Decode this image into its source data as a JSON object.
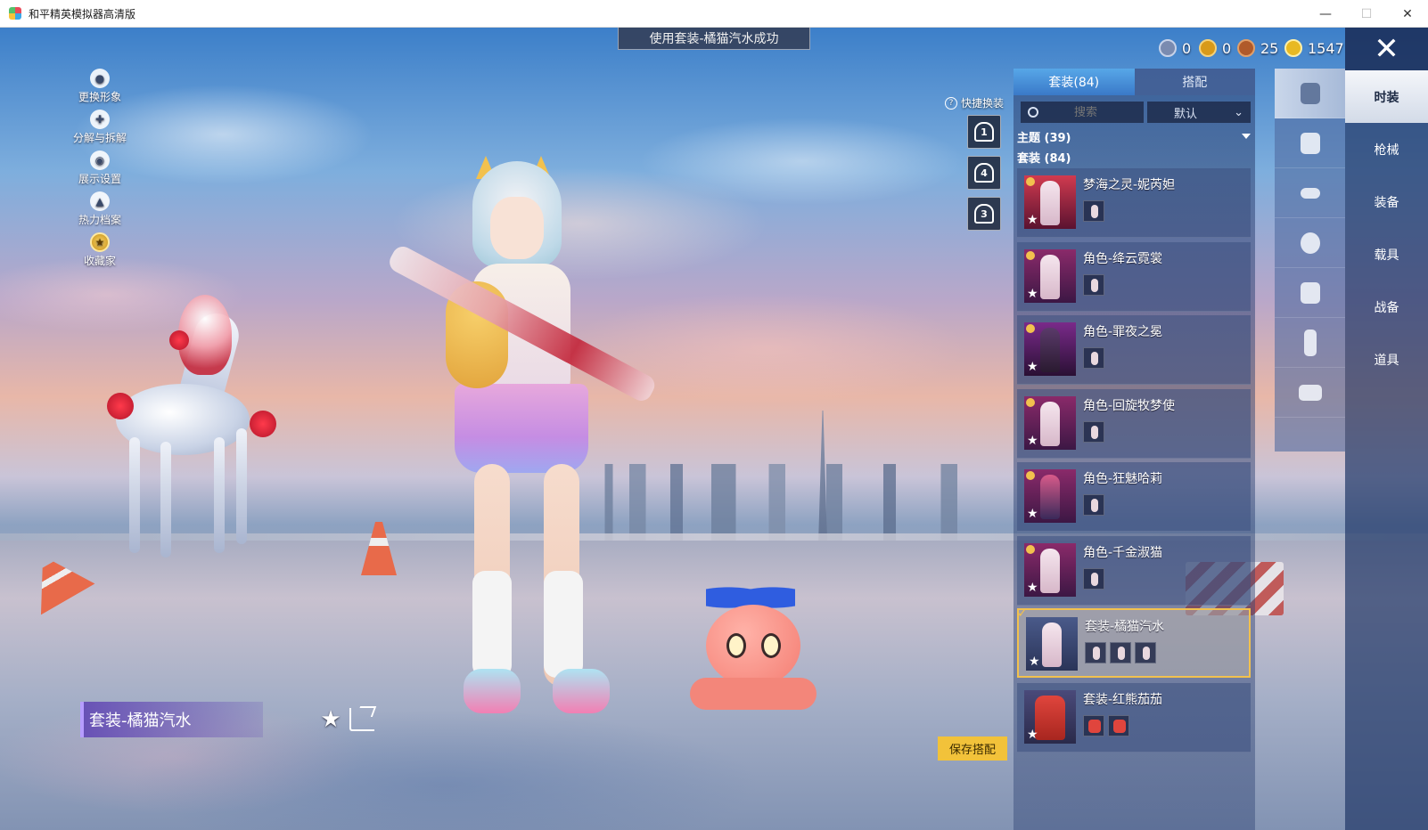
{
  "window": {
    "title": "和平精英模拟器高清版",
    "buttons": {
      "minimize": "—",
      "maximize": "☐",
      "close": "✕"
    }
  },
  "banner": {
    "text": "使用套装-橘猫汽水成功"
  },
  "left_menu": [
    {
      "label": "更换形象",
      "icon": "person-icon"
    },
    {
      "label": "分解与拆解",
      "icon": "puzzle-icon"
    },
    {
      "label": "展示设置",
      "icon": "eye-icon"
    },
    {
      "label": "热力档案",
      "icon": "flame-icon"
    },
    {
      "label": "收藏家",
      "icon": "collector-badge-icon"
    }
  ],
  "currencies": [
    {
      "name": "coin-a",
      "value": "0",
      "color": "#7a8bb0"
    },
    {
      "name": "coin-b",
      "value": "0",
      "color": "#d89a1a"
    },
    {
      "name": "coin-c",
      "value": "25",
      "color": "#b05a2a"
    },
    {
      "name": "coin-d",
      "value": "1547",
      "color": "#e8b923"
    }
  ],
  "quick_swap": {
    "label": "快捷换装",
    "slots": [
      "1",
      "4",
      "3"
    ]
  },
  "panel": {
    "tabs": [
      {
        "label": "套装(84)",
        "active": true
      },
      {
        "label": "搭配",
        "active": false
      }
    ],
    "search_placeholder": "搜索",
    "sort_value": "默认",
    "theme_section": "主题 (39)",
    "suit_section": "套装 (84)",
    "items": [
      {
        "name": "梦海之灵-妮芮妲",
        "parts": 1,
        "selected": false
      },
      {
        "name": "角色-绛云霓裳",
        "parts": 1,
        "selected": false
      },
      {
        "name": "角色-罪夜之冕",
        "parts": 1,
        "selected": false
      },
      {
        "name": "角色-回旋牧梦使",
        "parts": 1,
        "selected": false
      },
      {
        "name": "角色-狂魅哈莉",
        "parts": 1,
        "selected": false
      },
      {
        "name": "角色-千金淑猫",
        "parts": 1,
        "selected": false
      },
      {
        "name": "套装-橘猫汽水",
        "parts": 3,
        "selected": true
      },
      {
        "name": "套装-红熊茄茄",
        "parts": 2,
        "selected": false,
        "red": true
      }
    ]
  },
  "category_icons": [
    "outfit-icon",
    "hand-icon",
    "glasses-icon",
    "mask-icon",
    "shirt-icon",
    "pants-icon",
    "shoes-icon"
  ],
  "categories": [
    {
      "label": "时装",
      "active": true
    },
    {
      "label": "枪械",
      "active": false
    },
    {
      "label": "装备",
      "active": false
    },
    {
      "label": "载具",
      "active": false
    },
    {
      "label": "战备",
      "active": false
    },
    {
      "label": "道具",
      "active": false
    }
  ],
  "outfit_name": "套装-橘猫汽水",
  "save_button": "保存搭配",
  "colors": {
    "accent_gold": "#f2c14e",
    "tab_blue": "#3a79c8",
    "outfit_purple": "#6248b4"
  }
}
